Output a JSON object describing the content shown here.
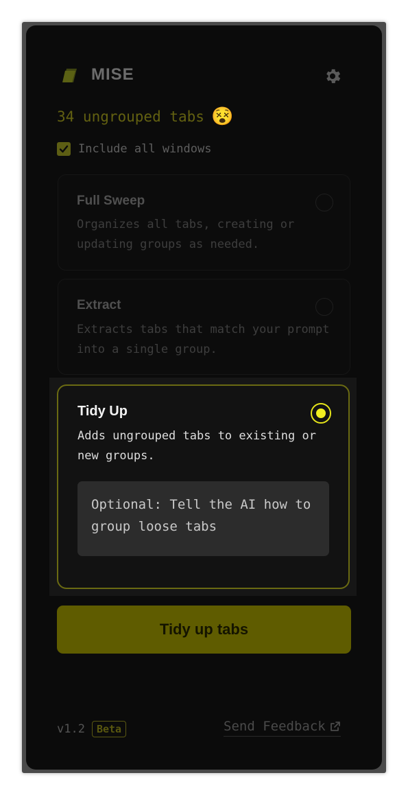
{
  "header": {
    "logo_icon": "stacked-cards-icon",
    "brand": "MISE",
    "settings_icon": "gear-icon"
  },
  "summary": {
    "tab_count_text": "34 ungrouped tabs",
    "emoji": "😵"
  },
  "options": {
    "include_all_windows_label": "Include all windows",
    "include_all_windows_checked": true
  },
  "modes": [
    {
      "title": "Full Sweep",
      "description": "Organizes all tabs, creating or updating groups as needed.",
      "selected": false
    },
    {
      "title": "Extract",
      "description": "Extracts tabs that match your prompt into a single group.",
      "selected": false
    },
    {
      "title": "Tidy Up",
      "description": "Adds ungrouped tabs to existing or new groups.",
      "selected": true,
      "prompt_placeholder": "Optional: Tell the AI how to group loose tabs"
    }
  ],
  "primary_button": {
    "label": "Tidy up tabs"
  },
  "footer": {
    "version": "v1.2",
    "badge": "Beta",
    "feedback_label": "Send Feedback",
    "feedback_icon": "external-link-icon"
  },
  "colors": {
    "accent": "#e6e51a",
    "accent_dim": "#5f5c00",
    "background": "#0b0b0b"
  }
}
